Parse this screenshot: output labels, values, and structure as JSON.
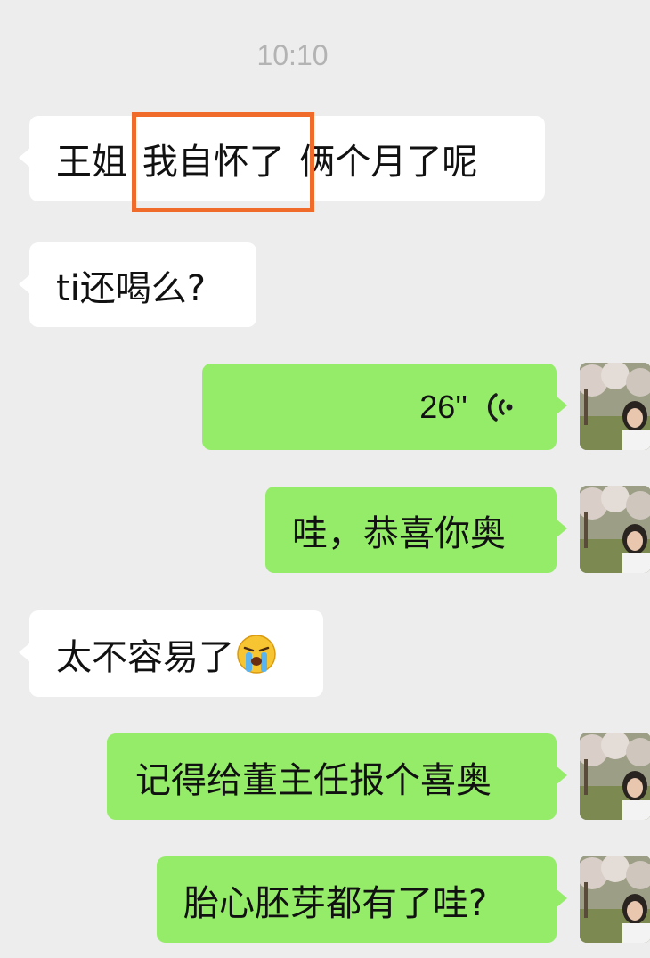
{
  "chat": {
    "timestamp": "10:10",
    "messages": [
      {
        "side": "in",
        "type": "text",
        "text": "王姐 我自怀了 俩个月了呢"
      },
      {
        "side": "in",
        "type": "text",
        "text": "ti还喝么?"
      },
      {
        "side": "out",
        "type": "voice",
        "duration": "26''",
        "icon": "voice-wave-icon"
      },
      {
        "side": "out",
        "type": "text",
        "text": "哇，恭喜你奥"
      },
      {
        "side": "in",
        "type": "text",
        "text": "太不容易了",
        "emoji": "crying-face-icon"
      },
      {
        "side": "out",
        "type": "text",
        "text": "记得给董主任报个喜奥"
      },
      {
        "side": "out",
        "type": "text",
        "text": "胎心胚芽都有了哇?"
      }
    ],
    "highlight_text": "我自怀了"
  },
  "colors": {
    "background": "#ededed",
    "incoming_bubble": "#ffffff",
    "outgoing_bubble": "#95ec69",
    "highlight_border": "#f06a2a",
    "timestamp_text": "#b3b3b3"
  }
}
